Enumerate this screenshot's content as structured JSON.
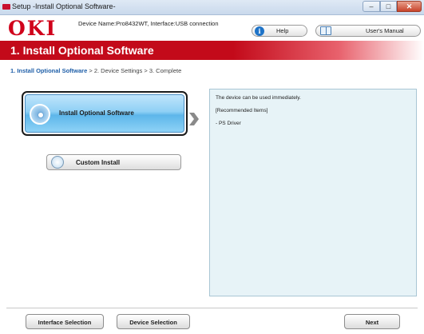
{
  "window": {
    "title": "Setup -Install Optional Software-",
    "controls": {
      "minimize": "–",
      "maximize": "□",
      "close": "✕"
    }
  },
  "header": {
    "logo": "OKI",
    "device_info": "Device Name:Pro8432WT, Interface:USB connection",
    "help_label": "Help",
    "manual_label": "User's Manual",
    "help_icon_glyph": "i"
  },
  "banner": {
    "title": "1. Install Optional Software"
  },
  "steps": {
    "current": "1. Install Optional Software",
    "rest": " > 2. Device Settings > 3. Complete"
  },
  "options": {
    "install_optional_label": "Install Optional Software",
    "custom_install_label": "Custom Install"
  },
  "info_panel": {
    "lines": [
      "The device can be used immediately.",
      "[Recommended Items]",
      " - PS Driver"
    ]
  },
  "footer": {
    "interface_selection_label": "Interface Selection",
    "device_selection_label": "Device Selection",
    "next_label": "Next"
  },
  "colors": {
    "brand_red": "#d0021b",
    "banner_red": "#c30a1a",
    "accent_blue": "#5db6ea",
    "panel_bg": "#e7f3f7"
  }
}
